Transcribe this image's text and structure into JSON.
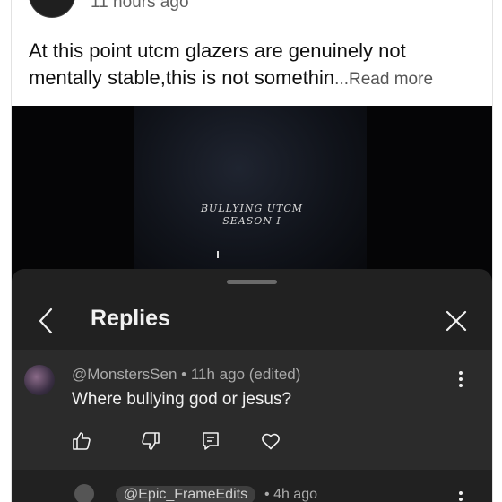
{
  "post": {
    "time": "11 hours ago",
    "text": "At this point utcm glazers are genuinely not mentally stable,this is not somethin",
    "ellipsis": "...",
    "read_more": "Read more"
  },
  "media": {
    "caption_line1": "BULLYING UTCM",
    "caption_line2": "SEASON I"
  },
  "sheet": {
    "title": "Replies"
  },
  "reply": {
    "author": "@MonstersSen",
    "separator": "•",
    "time": "11h ago (edited)",
    "text": "Where bullying god or jesus?"
  },
  "next_reply": {
    "mention": "@Epic_FrameEdits",
    "separator": "•",
    "time": "4h ago"
  },
  "icons": [
    "like-icon",
    "dislike-icon",
    "reply-icon",
    "heart-icon",
    "more-icon",
    "back-icon",
    "close-icon"
  ]
}
